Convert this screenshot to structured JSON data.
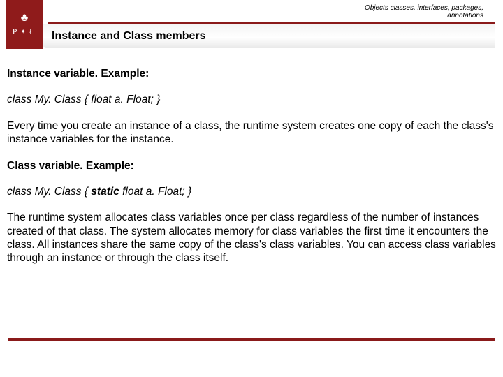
{
  "header": {
    "breadcrumb_line1": "Objects classes, interfaces, packages,",
    "breadcrumb_line2": "annotations",
    "logo_letters_left": "P",
    "logo_letters_right": "Ł",
    "title": "Instance and Class members"
  },
  "body": {
    "sec1_heading": "Instance variable. Example:",
    "sec1_code": "class My. Class { float a. Float; }",
    "sec1_para": "Every time you create an instance of a class, the runtime system creates one copy of each the class's instance variables for the instance.",
    "sec2_heading": "Class variable. Example:",
    "sec2_code_pre": "class My. Class { ",
    "sec2_code_kw": "static",
    "sec2_code_post": " float a. Float; }",
    "sec2_para": "The runtime system allocates class variables once per class regardless of the number of instances created of that class. The system allocates memory for class variables the first time it encounters the class. All instances share the same copy of the class's class variables. You can access class variables through an instance or through the class itself."
  },
  "colors": {
    "accent": "#8a1a1a"
  }
}
